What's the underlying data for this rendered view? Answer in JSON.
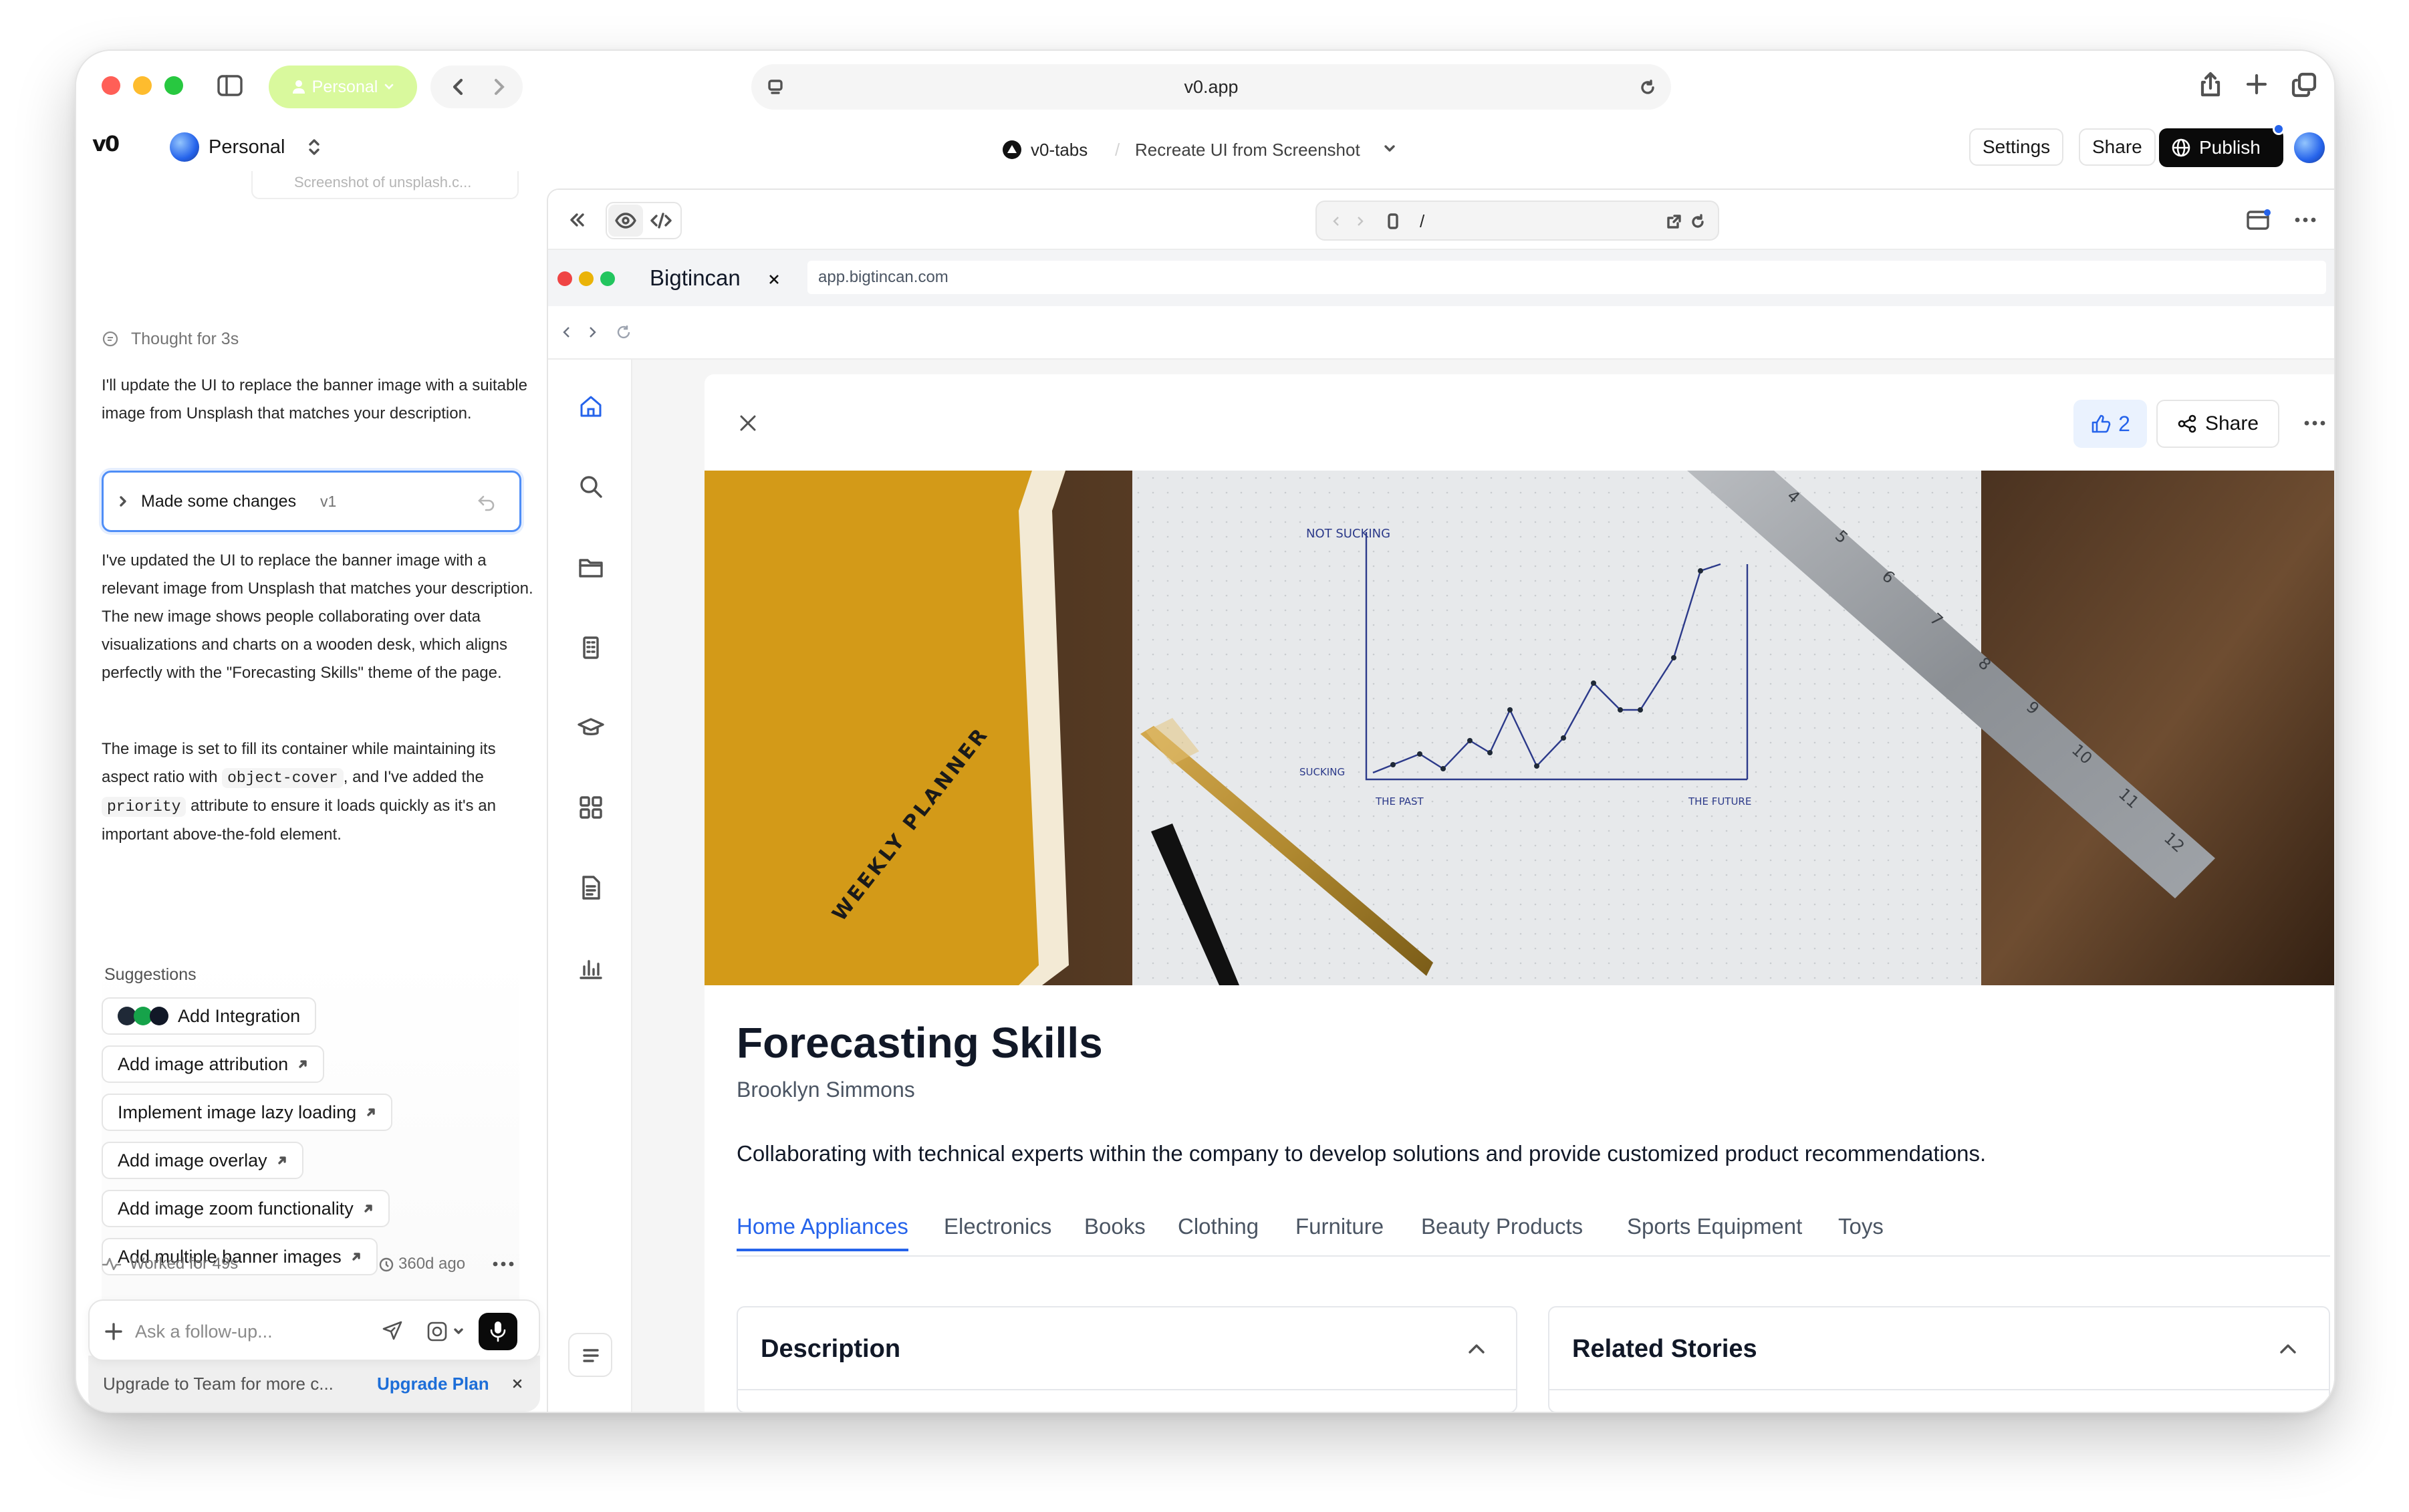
{
  "browser": {
    "profile_label": "Personal",
    "url": "v0.app"
  },
  "app": {
    "workspace": "Personal",
    "project_breadcrumb": "v0-tabs",
    "chat_title": "Recreate UI from Screenshot",
    "settings_label": "Settings",
    "share_label": "Share",
    "publish_label": "Publish"
  },
  "chat": {
    "attachment_label": "Screenshot of unsplash.c...",
    "thought_label": "Thought for 3s",
    "message1": "I'll update the UI to replace the banner image with a suitable image from Unsplash that matches your description.",
    "changes_label": "Made some changes",
    "version_label": "v1",
    "message2": "I've updated the UI to replace the banner image with a relevant image from Unsplash that matches your description. The new image shows people collaborating over data visualizations and charts on a wooden desk, which aligns perfectly with the \"Forecasting Skills\" theme of the page.",
    "message3_part1": "The image is set to fill its container while maintaining its aspect ratio with",
    "message3_code1": "object-cover",
    "message3_part2": ", and I've added the",
    "message3_code2": "priority",
    "message3_part3": "attribute to ensure it loads quickly as it's an important above-the-fold element.",
    "suggestions_title": "Suggestions",
    "suggestions": [
      "Add Integration",
      "Add image attribution",
      "Implement image lazy loading",
      "Add image overlay",
      "Add image zoom functionality",
      "Add multiple banner images"
    ],
    "worked_label": "Worked for 49s",
    "time_ago": "360d ago",
    "input_placeholder": "Ask a follow-up...",
    "upgrade_text": "Upgrade to Team for more c...",
    "upgrade_link": "Upgrade Plan"
  },
  "preview": {
    "path": "/",
    "tab_title": "Bigtincan",
    "address": "app.bigtincan.com"
  },
  "page": {
    "like_count": "2",
    "share_label": "Share",
    "banner_image": {
      "notebook_text": "WEEKLY PLANNER",
      "chart_top_label": "NOT SUCKING",
      "chart_bottom_label": "SUCKING",
      "chart_left_label": "THE PAST",
      "chart_right_label": "THE FUTURE",
      "ruler_numbers": [
        "4",
        "5",
        "6",
        "7",
        "8",
        "9",
        "10",
        "11",
        "12"
      ]
    },
    "title": "Forecasting Skills",
    "author": "Brooklyn Simmons",
    "description": "Collaborating with technical experts within the company to develop solutions and provide customized product recommendations.",
    "tabs": [
      "Home Appliances",
      "Electronics",
      "Books",
      "Clothing",
      "Furniture",
      "Beauty Products",
      "Sports Equipment",
      "Toys"
    ],
    "active_tab": "Home Appliances",
    "description_card_title": "Description",
    "related_card_title": "Related Stories"
  },
  "colors": {
    "accent_blue": "#2563eb",
    "link_blue": "#1d6ed8",
    "profile_chip": "#d9f99d",
    "traffic_red": "#ff5f57",
    "traffic_yellow": "#febc2e",
    "traffic_green": "#28c840"
  }
}
